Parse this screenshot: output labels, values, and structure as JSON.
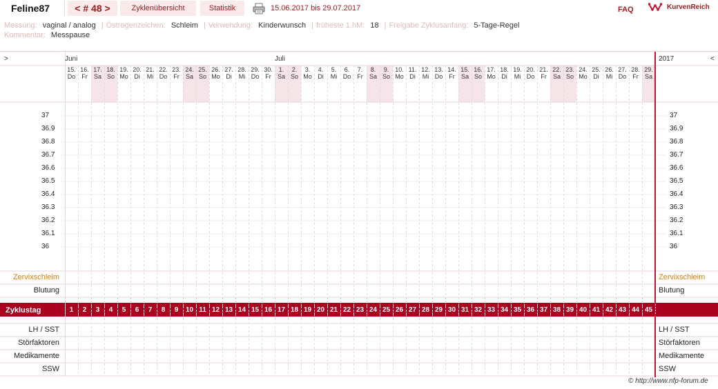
{
  "header": {
    "user": "Feline87",
    "cycle_label": "< # 48 >",
    "tab_overview": "Zyklenübersicht",
    "tab_stats": "Statistik",
    "date_range": "15.06.2017 bis 29.07.2017",
    "faq": "FAQ",
    "logo_text": "KurvenReich"
  },
  "info": {
    "measurement_label": "Messung:",
    "measurement_value": "vaginal / analog",
    "estrogen_label": "Östrogenzeichen:",
    "estrogen_value": "Schleim",
    "usage_label": "Verwendung:",
    "usage_value": "Kinderwunsch",
    "first_hm_label": "früheste 1.hM:",
    "first_hm_value": "18",
    "release_label": "Freigabe Zyklusanfang:",
    "release_value": "5-Tage-Regel",
    "comment_label": "Kommentar:",
    "comment_value": "Messpause"
  },
  "chart": {
    "nav_prev": ">",
    "nav_next": "<",
    "year": "2017",
    "months": [
      {
        "label": "Juni",
        "col": 0
      },
      {
        "label": "Juli",
        "col": 16
      }
    ],
    "days": [
      {
        "d": "15.",
        "w": "Do"
      },
      {
        "d": "16.",
        "w": "Fr"
      },
      {
        "d": "17.",
        "w": "Sa"
      },
      {
        "d": "18.",
        "w": "So"
      },
      {
        "d": "19.",
        "w": "Mo"
      },
      {
        "d": "20.",
        "w": "Di"
      },
      {
        "d": "21.",
        "w": "Mi"
      },
      {
        "d": "22.",
        "w": "Do"
      },
      {
        "d": "23.",
        "w": "Fr"
      },
      {
        "d": "24.",
        "w": "Sa"
      },
      {
        "d": "25.",
        "w": "So"
      },
      {
        "d": "26.",
        "w": "Mo"
      },
      {
        "d": "27.",
        "w": "Di"
      },
      {
        "d": "28.",
        "w": "Mi"
      },
      {
        "d": "29.",
        "w": "Do"
      },
      {
        "d": "30.",
        "w": "Fr"
      },
      {
        "d": "1.",
        "w": "Sa"
      },
      {
        "d": "2.",
        "w": "So"
      },
      {
        "d": "3.",
        "w": "Mo"
      },
      {
        "d": "4.",
        "w": "Di"
      },
      {
        "d": "5.",
        "w": "Mi"
      },
      {
        "d": "6.",
        "w": "Do"
      },
      {
        "d": "7.",
        "w": "Fr"
      },
      {
        "d": "8.",
        "w": "Sa"
      },
      {
        "d": "9.",
        "w": "So"
      },
      {
        "d": "10.",
        "w": "Mo"
      },
      {
        "d": "11.",
        "w": "Di"
      },
      {
        "d": "12.",
        "w": "Mi"
      },
      {
        "d": "13.",
        "w": "Do"
      },
      {
        "d": "14.",
        "w": "Fr"
      },
      {
        "d": "15.",
        "w": "Sa"
      },
      {
        "d": "16.",
        "w": "So"
      },
      {
        "d": "17.",
        "w": "Mo"
      },
      {
        "d": "18.",
        "w": "Di"
      },
      {
        "d": "19.",
        "w": "Mi"
      },
      {
        "d": "20.",
        "w": "Do"
      },
      {
        "d": "21.",
        "w": "Fr"
      },
      {
        "d": "22.",
        "w": "Sa"
      },
      {
        "d": "23.",
        "w": "So"
      },
      {
        "d": "24.",
        "w": "Mo"
      },
      {
        "d": "25.",
        "w": "Di"
      },
      {
        "d": "26.",
        "w": "Mi"
      },
      {
        "d": "27.",
        "w": "Do"
      },
      {
        "d": "28.",
        "w": "Fr"
      },
      {
        "d": "29.",
        "w": "Sa"
      }
    ],
    "temps": [
      "37",
      "36.9",
      "36.8",
      "36.7",
      "36.6",
      "36.5",
      "36.4",
      "36.3",
      "36.2",
      "36.1",
      "36"
    ],
    "row_labels": {
      "cervix": "Zervixschleim",
      "bleeding": "Blutung",
      "cycle_day": "Zyklustag",
      "lh": "LH / SST",
      "disturb": "Störfaktoren",
      "meds": "Medikamente",
      "ssw": "SSW"
    },
    "colors": {
      "accent": "#a8001e",
      "weekend": "#f5e4e8",
      "cervix_text": "#e07b00",
      "grid": "#e6d5d5"
    }
  },
  "footer": {
    "copyright": "© http://www.nfp-forum.de"
  }
}
